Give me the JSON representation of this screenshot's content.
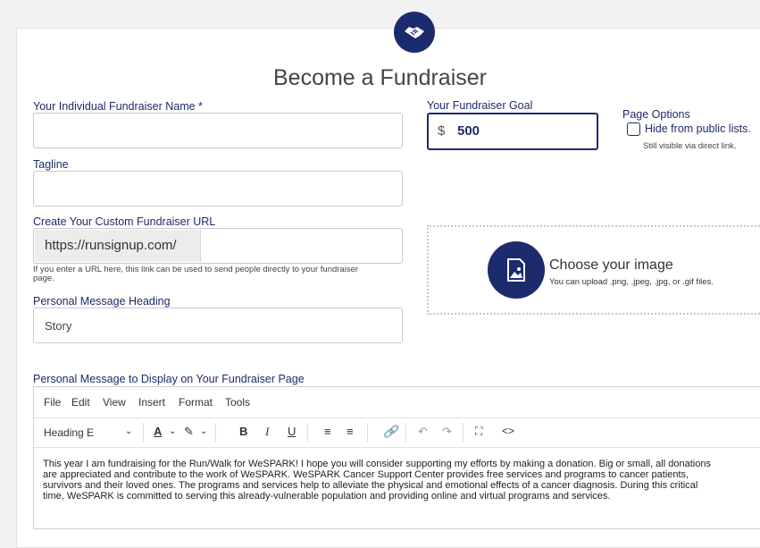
{
  "page": {
    "title": "Become a Fundraiser"
  },
  "logo": {
    "icon": "handshake-icon"
  },
  "fields": {
    "name_label": "Your Individual Fundraiser Name *",
    "name_value": "",
    "tagline_label": "Tagline",
    "tagline_value": "",
    "url_label": "Create Your Custom Fundraiser URL",
    "url_prefix": "https://runsignup.com/",
    "url_help": "If you enter a URL here, this link can be used to send people directly to your fundraiser page.",
    "heading_label": "Personal Message Heading",
    "heading_value": "Story",
    "message_label": "Personal Message to Display on Your Fundraiser Page"
  },
  "goal": {
    "label": "Your Fundraiser Goal",
    "currency": "$",
    "value": "500"
  },
  "page_options": {
    "label": "Page Options",
    "hide_label": "Hide from public lists.",
    "hide_note": "Still visible via direct link.",
    "hide_checked": false
  },
  "image_upload": {
    "title": "Choose your image",
    "subtitle": "You can upload .png, .jpeg, .jpg, or .gif files.",
    "icon": "image-upload-icon"
  },
  "editor": {
    "menus": [
      "File",
      "Edit",
      "View",
      "Insert",
      "Format",
      "Tools"
    ],
    "block_format": "Heading E",
    "content": [
      "This year I am fundraising for the Run/Walk for WeSPARK! I hope you will consider supporting my efforts by making a donation. Big or small, all donations",
      "are appreciated and contribute to the work of WeSPARK. WeSPARK Cancer Support Center provides free services and programs to cancer patients,",
      "survivors and their loved ones. The programs and services help to alleviate the physical and emotional effects of a cancer diagnosis. During this critical",
      "time, WeSPARK is committed to serving this already-vulnerable population and providing online and virtual programs and services."
    ]
  },
  "colors": {
    "brand": "#1c2a6e",
    "label": "#1f2a6b"
  }
}
